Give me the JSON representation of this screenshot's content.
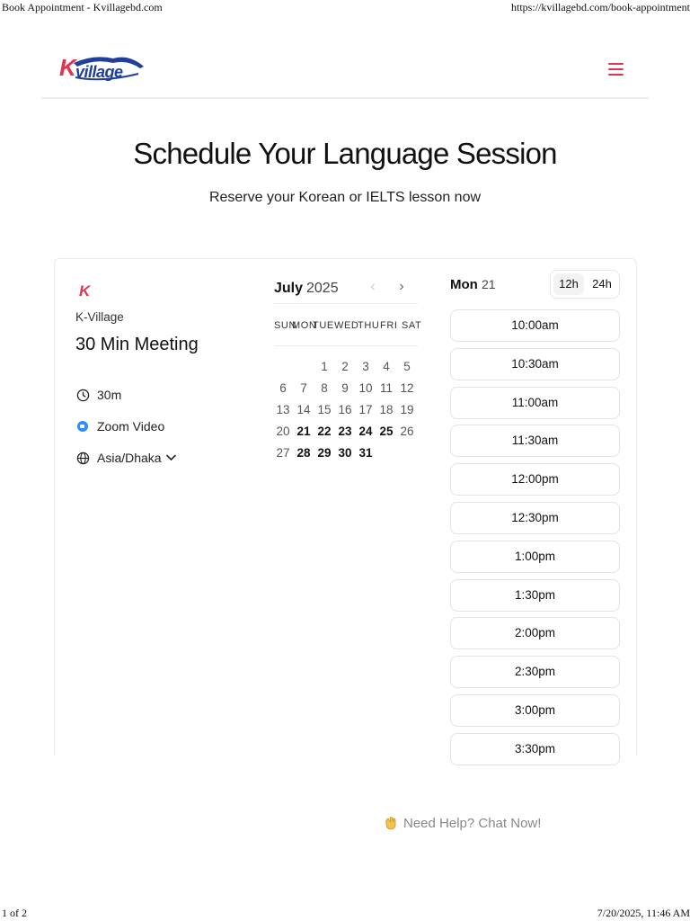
{
  "print_header": {
    "title": "Book Appointment - Kvillagebd.com",
    "url": "https://kvillagebd.com/book-appointment"
  },
  "print_footer": {
    "page": "1 of 2",
    "datetime": "7/20/2025, 11:46 AM"
  },
  "navbar": {
    "logo_k": "K",
    "logo_word": "village",
    "menu_icon": "hamburger-menu-icon",
    "accent_color": "#e0344f",
    "brand_blue": "#1f3f9b"
  },
  "hero": {
    "title": "Schedule Your Language Session",
    "subtitle": "Reserve your Korean or IELTS lesson now"
  },
  "event": {
    "brand_mark": "K",
    "org_name": "K-Village",
    "title": "30 Min Meeting",
    "duration": "30m",
    "location": "Zoom Video",
    "timezone": "Asia/Dhaka"
  },
  "calendar": {
    "month": "July",
    "year": "2025",
    "weekdays": [
      "SUN",
      "MON",
      "TUE",
      "WED",
      "THU",
      "FRI",
      "SAT"
    ],
    "start_weekday_index": 2,
    "days_in_month": 31,
    "available_days": [
      21,
      22,
      23,
      24,
      25,
      28,
      29,
      30,
      31
    ]
  },
  "slots": {
    "day_name": "Mon",
    "day_number": "21",
    "format_12h": "12h",
    "format_24h": "24h",
    "selected_format": "12h",
    "times": [
      "10:00am",
      "10:30am",
      "11:00am",
      "11:30am",
      "12:00pm",
      "12:30pm",
      "1:00pm",
      "1:30pm",
      "2:00pm",
      "2:30pm",
      "3:00pm",
      "3:30pm"
    ]
  },
  "help": {
    "label": "Need Help? Chat Now!",
    "icon": "waving-hand-icon"
  }
}
